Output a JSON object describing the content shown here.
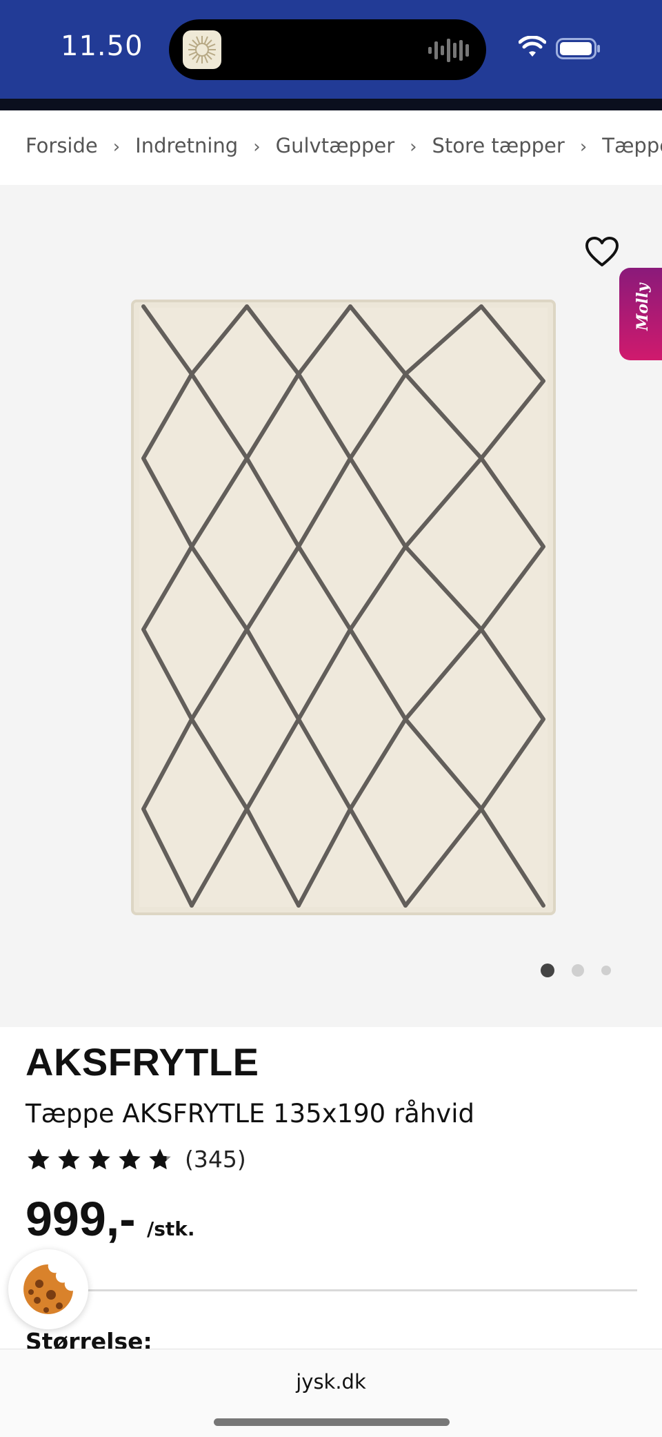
{
  "status": {
    "time": "11.50"
  },
  "breadcrumb": {
    "items": [
      "Forside",
      "Indretning",
      "Gulvtæpper",
      "Store tæpper",
      "Tæppe"
    ],
    "separator": "›"
  },
  "gallery": {
    "favorite_icon": "heart-icon",
    "molly_label": "Molly",
    "dots_total": 3,
    "active_dot": 1
  },
  "product": {
    "brand": "AKSFRYTLE",
    "name": "Tæppe AKSFRYTLE 135x190 råhvid",
    "rating": 4.8,
    "review_count": "(345)",
    "price": "999,-",
    "unit": "/stk.",
    "size_label": "Størrelse:"
  },
  "browser": {
    "url": "jysk.dk"
  },
  "colors": {
    "status_bar": "#223b96",
    "molly_gradient_start": "#8a1a7a",
    "molly_gradient_end": "#d01a6d",
    "gallery_bg": "#f4f4f4"
  }
}
